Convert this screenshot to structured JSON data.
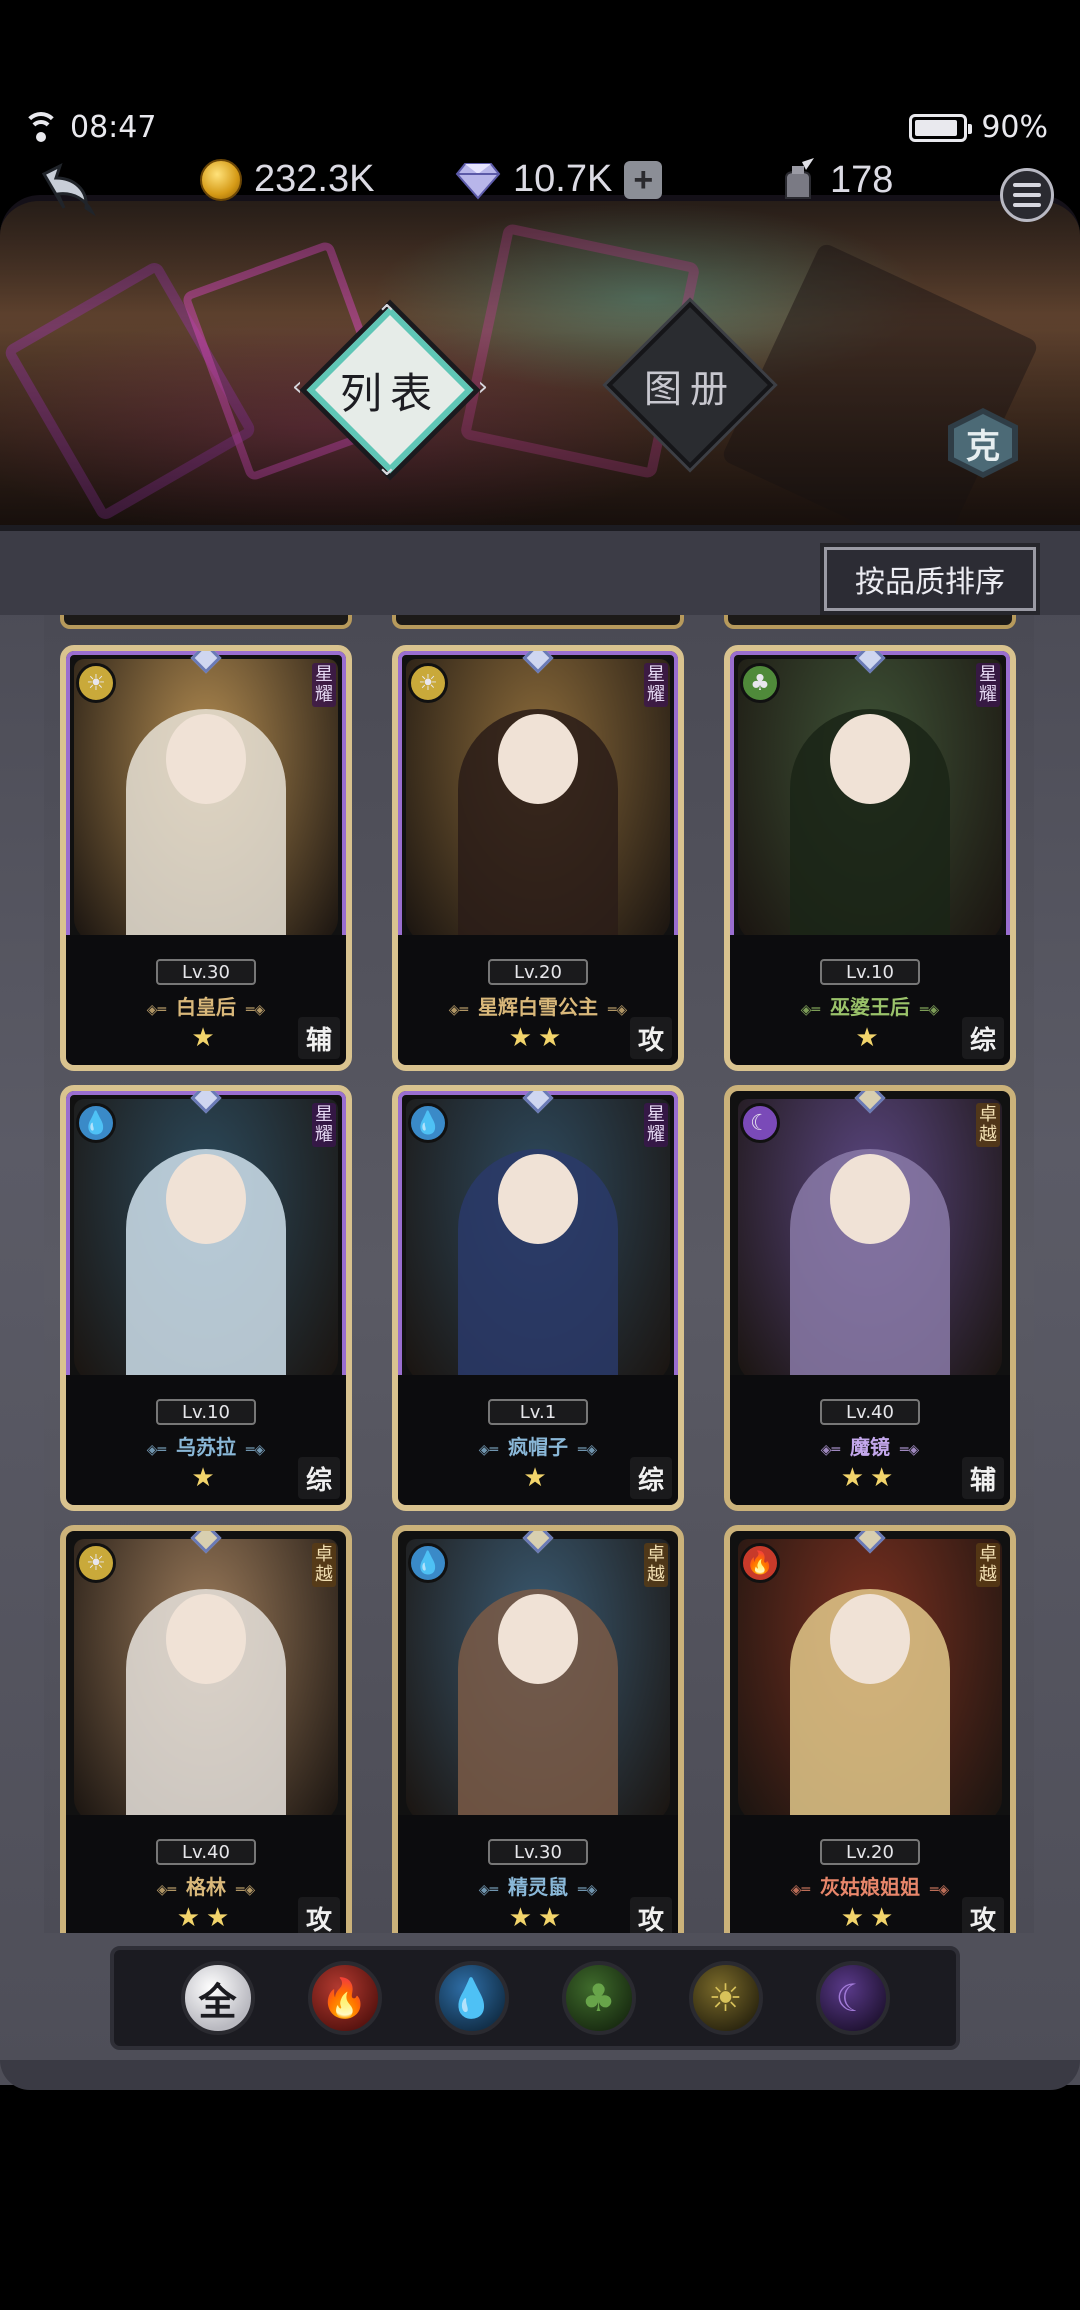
{
  "status_bar": {
    "time": "08:47",
    "battery": "90%",
    "battery_level": 0.9
  },
  "header": {
    "gold": "232.3K",
    "diamonds": "10.7K",
    "ink": "178",
    "plus_label": "+"
  },
  "tabs": {
    "list": "列表",
    "album": "图册",
    "counter": "克"
  },
  "sort_button": "按品质排序",
  "cards": [
    {
      "level": "Lv.30",
      "name": "白皇后",
      "stars": "★",
      "role": "辅",
      "rank": "星耀",
      "element": "light",
      "bg": "#b08a50",
      "figure": "#e8e2d6",
      "name_color": "#d9b87a"
    },
    {
      "level": "Lv.20",
      "name": "星辉白雪公主",
      "stars": "★★",
      "role": "攻",
      "rank": "星耀",
      "element": "light",
      "bg": "#8a6a3a",
      "figure": "#2a1c18",
      "name_color": "#d9b87a"
    },
    {
      "level": "Lv.10",
      "name": "巫婆王后",
      "stars": "★",
      "role": "综",
      "rank": "星耀",
      "element": "wood",
      "bg": "#3e5236",
      "figure": "#1a2416",
      "name_color": "#9ac26a"
    },
    {
      "level": "Lv.10",
      "name": "乌苏拉",
      "stars": "★",
      "role": "综",
      "rank": "星耀",
      "element": "water",
      "bg": "#2c4a5c",
      "figure": "#cfe0ec",
      "name_color": "#8ab8d8"
    },
    {
      "level": "Lv.1",
      "name": "疯帽子",
      "stars": "★",
      "role": "综",
      "rank": "星耀",
      "element": "water",
      "bg": "#2e4a5e",
      "figure": "#2a3a6a",
      "name_color": "#8ab8d8"
    },
    {
      "level": "Lv.40",
      "name": "魔镜",
      "stars": "★★",
      "role": "辅",
      "rank": "卓越",
      "element": "dark",
      "bg": "#5a4680",
      "figure": "#8a7aa8",
      "name_color": "#c4a8ec"
    },
    {
      "level": "Lv.40",
      "name": "格林",
      "stars": "★★",
      "role": "攻",
      "rank": "卓越",
      "element": "light",
      "bg": "#9a7a5a",
      "figure": "#e6e2dc",
      "name_color": "#d9b87a"
    },
    {
      "level": "Lv.30",
      "name": "精灵鼠",
      "stars": "★★",
      "role": "攻",
      "rank": "卓越",
      "element": "water",
      "bg": "#3a5a72",
      "figure": "#7a5a46",
      "name_color": "#8ab8d8"
    },
    {
      "level": "Lv.20",
      "name": "灰姑娘姐姐",
      "stars": "★★",
      "role": "攻",
      "rank": "卓越",
      "element": "fire",
      "bg": "#7a3020",
      "figure": "#e2c88a",
      "name_color": "#e8866a"
    }
  ],
  "filters": [
    {
      "label": "全",
      "element": "all"
    },
    {
      "label": "",
      "element": "fire",
      "icon": "fire-icon"
    },
    {
      "label": "",
      "element": "water",
      "icon": "water-drop-icon"
    },
    {
      "label": "",
      "element": "wood",
      "icon": "leaf-icon"
    },
    {
      "label": "",
      "element": "light",
      "icon": "sun-icon"
    },
    {
      "label": "",
      "element": "dark",
      "icon": "moon-icon"
    }
  ]
}
